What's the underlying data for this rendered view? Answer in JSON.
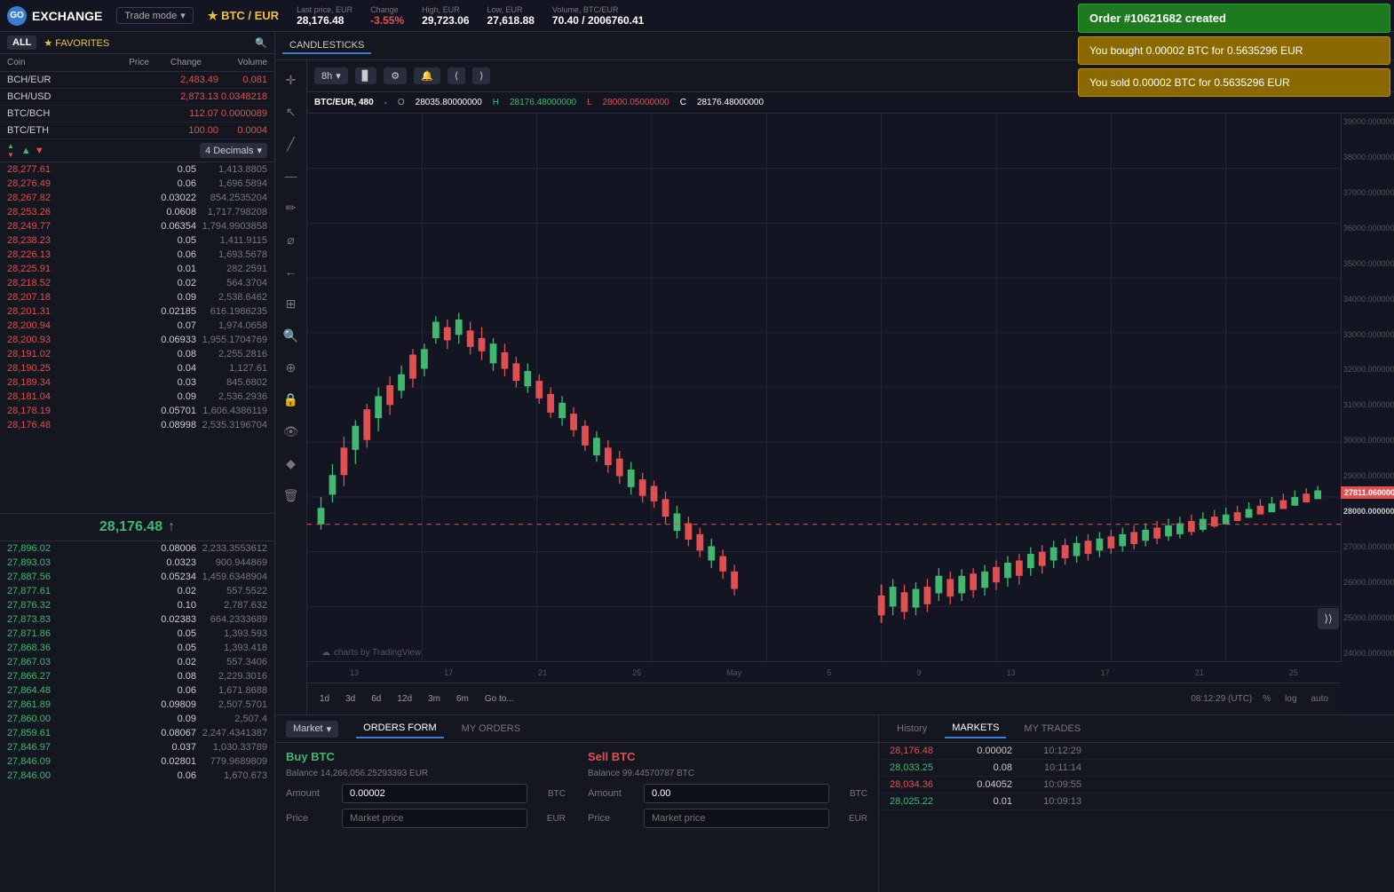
{
  "logo": {
    "icon": "GO",
    "text": "EXCHANGE"
  },
  "trademode": {
    "label": "Trade mode"
  },
  "pair": {
    "name": "★ BTC / EUR",
    "last_price_label": "Last price, EUR",
    "last_price": "28,176.48",
    "change_label": "Change",
    "change": "-3.55%",
    "high_label": "High, EUR",
    "high": "29,723.06",
    "low_label": "Low, EUR",
    "low": "27,618.88",
    "volume_label": "Volume, BTC/EUR",
    "volume": "70.40 / 2006760.41"
  },
  "notifications": {
    "order": {
      "text": "Order #10621682 created"
    },
    "buy": {
      "text": "You bought 0.00002 BTC for 0.5635296 EUR"
    },
    "sell": {
      "text": "You sold 0.00002 BTC for 0.5635296 EUR"
    }
  },
  "filters": {
    "all": "ALL",
    "favorites": "★ FAVORITES"
  },
  "orderbook": {
    "headers": {
      "coin": "Coin",
      "price": "Price",
      "change": "Change",
      "volume": "Volume"
    },
    "coins": [
      {
        "name": "BCH/EUR",
        "price": "2,483.49",
        "change": "0.081",
        "type": "red"
      },
      {
        "name": "BCH/USD",
        "price": "2,873.13",
        "change": "0.0348218",
        "type": "red"
      },
      {
        "name": "BTC/BCH",
        "price": "112.07",
        "change": "0.0000089",
        "type": "red"
      },
      {
        "name": "BTC/ETH",
        "price": "100.00",
        "change": "0.0004",
        "type": "red"
      }
    ]
  },
  "decimals": {
    "label": "4 Decimals"
  },
  "asks": [
    {
      "price": "28,277.61",
      "amount": "0.05",
      "total": "1,413.8805"
    },
    {
      "price": "28,276.49",
      "amount": "0.06",
      "total": "1,696.5894"
    },
    {
      "price": "28,267.82",
      "amount": "0.03022",
      "total": "854.2535204"
    },
    {
      "price": "28,253.26",
      "amount": "0.0608",
      "total": "1,717.798208"
    },
    {
      "price": "28,249.77",
      "amount": "0.06354",
      "total": "1,794.9903858"
    },
    {
      "price": "28,238.23",
      "amount": "0.05",
      "total": "1,411.9115"
    },
    {
      "price": "28,226.13",
      "amount": "0.06",
      "total": "1,693.5678"
    },
    {
      "price": "28,225.91",
      "amount": "0.01",
      "total": "282.2591"
    },
    {
      "price": "28,218.52",
      "amount": "0.02",
      "total": "564.3704"
    },
    {
      "price": "28,207.18",
      "amount": "0.09",
      "total": "2,538.6462"
    },
    {
      "price": "28,201.31",
      "amount": "0.02185",
      "total": "616.1986235"
    },
    {
      "price": "28,200.94",
      "amount": "0.07",
      "total": "1,974.0658"
    },
    {
      "price": "28,200.93",
      "amount": "0.06933",
      "total": "1,955.1704769"
    },
    {
      "price": "28,191.02",
      "amount": "0.08",
      "total": "2,255.2816"
    },
    {
      "price": "28,190.25",
      "amount": "0.04",
      "total": "1,127.61"
    },
    {
      "price": "28,189.34",
      "amount": "0.03",
      "total": "845.6802"
    },
    {
      "price": "28,181.04",
      "amount": "0.09",
      "total": "2,536.2936"
    },
    {
      "price": "28,178.19",
      "amount": "0.05701",
      "total": "1,606.4386119"
    },
    {
      "price": "28,176.48",
      "amount": "0.08998",
      "total": "2,535.3196704"
    }
  ],
  "current_price": "28,176.48",
  "bids": [
    {
      "price": "27,896.02",
      "amount": "0.08006",
      "total": "2,233.3553612"
    },
    {
      "price": "27,893.03",
      "amount": "0.0323",
      "total": "900.944869"
    },
    {
      "price": "27,887.56",
      "amount": "0.05234",
      "total": "1,459.6348904"
    },
    {
      "price": "27,877.61",
      "amount": "0.02",
      "total": "557.5522"
    },
    {
      "price": "27,876.32",
      "amount": "0.10",
      "total": "2,787.632"
    },
    {
      "price": "27,873.83",
      "amount": "0.02383",
      "total": "664.2333689"
    },
    {
      "price": "27,871.86",
      "amount": "0.05",
      "total": "1,393.593"
    },
    {
      "price": "27,868.36",
      "amount": "0.05",
      "total": "1,393.418"
    },
    {
      "price": "27,867.03",
      "amount": "0.02",
      "total": "557.3406"
    },
    {
      "price": "27,866.27",
      "amount": "0.08",
      "total": "2,229.3016"
    },
    {
      "price": "27,864.48",
      "amount": "0.06",
      "total": "1,671.8688"
    },
    {
      "price": "27,861.89",
      "amount": "0.09809",
      "total": "2,507.5701"
    },
    {
      "price": "27,860.00",
      "amount": "0.09",
      "total": "2,507.4"
    },
    {
      "price": "27,859.61",
      "amount": "0.08067",
      "total": "2,247.4341387"
    },
    {
      "price": "27,846.97",
      "amount": "0.037",
      "total": "1,030.33789"
    },
    {
      "price": "27,846.09",
      "amount": "0.02801",
      "total": "779.9689809"
    },
    {
      "price": "27,846.00",
      "amount": "0.06",
      "total": "1,670.673"
    }
  ],
  "chart": {
    "tab": "CANDLESTICKS",
    "pair_label": "BTC/EUR, 480",
    "timeframe": "8h",
    "ohlc": {
      "o_label": "O",
      "o_val": "28035.80000000",
      "h_label": "H",
      "h_val": "28176.48000000",
      "l_label": "L",
      "l_val": "28000.05000000",
      "c_label": "C",
      "c_val": "28176.48000000"
    },
    "timeframes": [
      "1d",
      "3d",
      "6d",
      "12d",
      "3m",
      "6m"
    ],
    "goto": "Go to...",
    "time_display": "08:12:29 (UTC)",
    "scale_pct": "%",
    "scale_log": "log",
    "scale_auto": "auto",
    "price_axis": [
      "39000.00000000",
      "38000.00000000",
      "37000.00000000",
      "36000.00000000",
      "35000.00000000",
      "34000.00000000",
      "33000.00000000",
      "32000.00000000",
      "31000.00000000",
      "30000.00000000",
      "29000.00000000",
      "28000.00000000",
      "27000.00000000",
      "26000.00000000",
      "25000.00000000",
      "24000.00000000"
    ],
    "time_axis": [
      "13",
      "17",
      "21",
      "25",
      "May",
      "5",
      "9",
      "13",
      "17",
      "21",
      "25"
    ],
    "current_price_marker": "27811.06000000"
  },
  "orders": {
    "form_tab": "ORDERS FORM",
    "my_orders_tab": "MY ORDERS",
    "market_label": "Market",
    "buy": {
      "title": "Buy BTC",
      "balance_label": "Balance",
      "balance_val": "14,266,056.25293393 EUR",
      "amount_label": "Amount",
      "amount_val": "0.00002",
      "amount_unit": "BTC",
      "price_label": "Price",
      "price_placeholder": "Market price",
      "price_unit": "EUR"
    },
    "sell": {
      "title": "Sell BTC",
      "balance_label": "Balance",
      "balance_val": "99.44570787 BTC",
      "amount_label": "Amount",
      "amount_val": "0.00",
      "amount_unit": "BTC",
      "price_label": "Price",
      "price_placeholder": "Market price",
      "price_unit": "EUR"
    }
  },
  "history": {
    "title": "History",
    "tabs": {
      "markets": "MARKETS",
      "my_trades": "MY TRADES"
    },
    "rows": [
      {
        "price": "28,176.48",
        "amount": "0.00002",
        "time": "10:12:29",
        "type": "red"
      },
      {
        "price": "28,033.25",
        "amount": "0.08",
        "time": "10:11:14",
        "type": "green"
      },
      {
        "price": "28,034.36",
        "amount": "0.04052",
        "time": "10:09:55",
        "type": "red"
      },
      {
        "price": "28,025.22",
        "amount": "0.01",
        "time": "10:09:13",
        "type": "green"
      }
    ]
  }
}
